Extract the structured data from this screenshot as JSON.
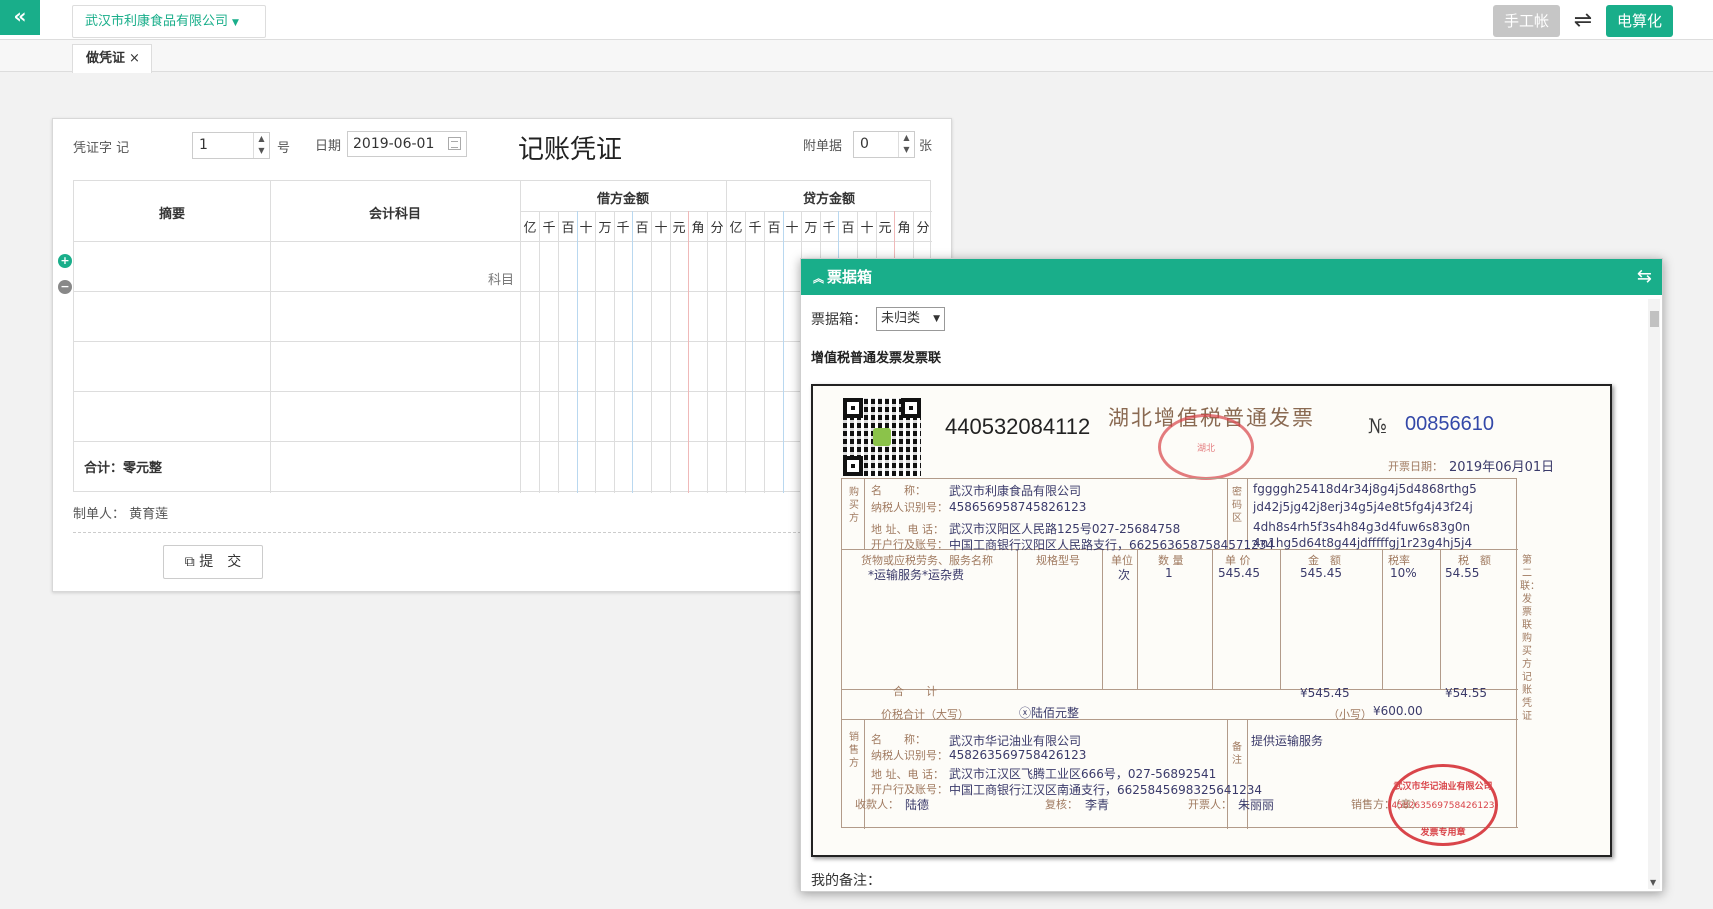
{
  "header": {
    "collapse_glyph": "«",
    "company": "武汉市利康食品有限公司",
    "manual_label": "手工帐",
    "swap_glyph": "⇌",
    "computer_label": "电算化"
  },
  "tabs": [
    {
      "label": "做凭证",
      "close": "×"
    }
  ],
  "voucher": {
    "word_label": "凭证字 记",
    "number": "1",
    "number_suffix": "号",
    "date_label": "日期",
    "date": "2019-06-01",
    "title": "记账凭证",
    "attach_label": "附单据",
    "attach_count": "0",
    "attach_suffix": "张",
    "columns": {
      "summary": "摘要",
      "subject": "会计科目",
      "debit": "借方金额",
      "credit": "贷方金额"
    },
    "digits": [
      "亿",
      "千",
      "百",
      "十",
      "万",
      "千",
      "百",
      "十",
      "元",
      "角",
      "分"
    ],
    "subject_hint": "科目",
    "total": "合计：零元整",
    "maker_label": "制单人：",
    "maker": "黄育莲",
    "submit_label": "提　交"
  },
  "billbox": {
    "title": "票据箱",
    "box_label": "票据箱：",
    "box_value": "未归类",
    "invoice_type": "增值税普通发票发票联",
    "remark_label": "我的备注："
  },
  "invoice": {
    "code": "440532084112",
    "title": "湖北增值税普通发票",
    "no_label": "№",
    "no": "00856610",
    "date_label": "开票日期：",
    "date": "2019年06月01日",
    "buyer_side": "购买方",
    "buyer_labels": [
      "名　　称：",
      "纳税人识别号：",
      "地 址、电 话：",
      "开户行及账号："
    ],
    "buyer_name": "武汉市利康食品有限公司",
    "buyer_tax_id": "458656958745826123",
    "buyer_addr": "武汉市汉阳区人民路125号027-25684758",
    "buyer_bank": "中国工商银行汉阳区人民路支行，6625636587584571234",
    "password_side": "密码区",
    "password_lines": [
      "fggggh25418d4r34j8g4j5d4868rthg5",
      "jd42j5jg42j8erj34g5j4e8t5fg4j43f24j",
      "4dh8s4rh5f3s4h84g3d4fuw6s83g0n",
      "4n1hg5d64t8g44jdfffffgj1r23g4hj5j4"
    ],
    "item_headers": [
      "货物或应税劳务、服务名称",
      "规格型号",
      "单位",
      "数 量",
      "单 价",
      "金　额",
      "税率",
      "税　额"
    ],
    "item": {
      "name": "*运输服务*运杂费",
      "unit": "次",
      "qty": "1",
      "price": "545.45",
      "amount": "545.45",
      "rate": "10%",
      "tax": "54.55"
    },
    "sum_label": "合　　计",
    "sum_amount": "¥545.45",
    "sum_tax": "¥54.55",
    "total_label": "价税合计（大写）",
    "total_upper": "ⓧ陆佰元整",
    "total_lower_label": "（小写）",
    "total_lower": "¥600.00",
    "seller_side": "销售方",
    "seller_labels": [
      "名　　称：",
      "纳税人识别号：",
      "地 址、电 话：",
      "开户行及账号："
    ],
    "seller_name": "武汉市华记油业有限公司",
    "seller_tax_id": "458263569758426123",
    "seller_addr": "武汉市江汉区飞腾工业区666号，027-56892541",
    "seller_bank": "中国工商银行江汉区南通支行，6625845698325641234",
    "remark_side": "备注",
    "remark": "提供运输服务",
    "payee_label": "收款人：",
    "payee": "陆德",
    "reviewer_label": "复核：",
    "reviewer": "李青",
    "issuer_label": "开票人：",
    "issuer": "朱丽丽",
    "seller_stamp_label": "销售方：（章）",
    "right_side": "第二联：发票联 购买方记账凭证",
    "stamp_top_text": "湖北",
    "stamp_seller_name": "武汉市华记油业有限公司",
    "stamp_seller_id": "458263569758426123",
    "stamp_seller_type": "发票专用章"
  },
  "colors": {
    "accent": "#19ae8a",
    "stamp": "#d9454a"
  }
}
